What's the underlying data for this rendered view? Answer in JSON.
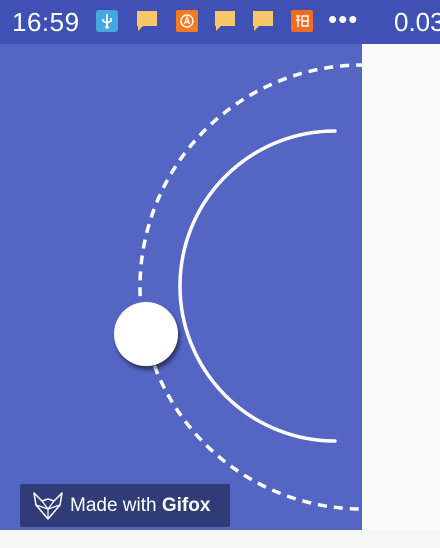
{
  "status_bar": {
    "time": "16:59",
    "more": "•••",
    "speed": "0.03",
    "icons": [
      "usb-icon",
      "message-icon",
      "app-store-icon",
      "message-icon",
      "message-icon",
      "taobao-icon"
    ],
    "background": "#3f51b5"
  },
  "canvas": {
    "background": "#5465c4"
  },
  "badge": {
    "prefix": "Made with ",
    "brand": "Gifox",
    "icon": "fox-logo-icon",
    "background": "#2f3c77"
  }
}
